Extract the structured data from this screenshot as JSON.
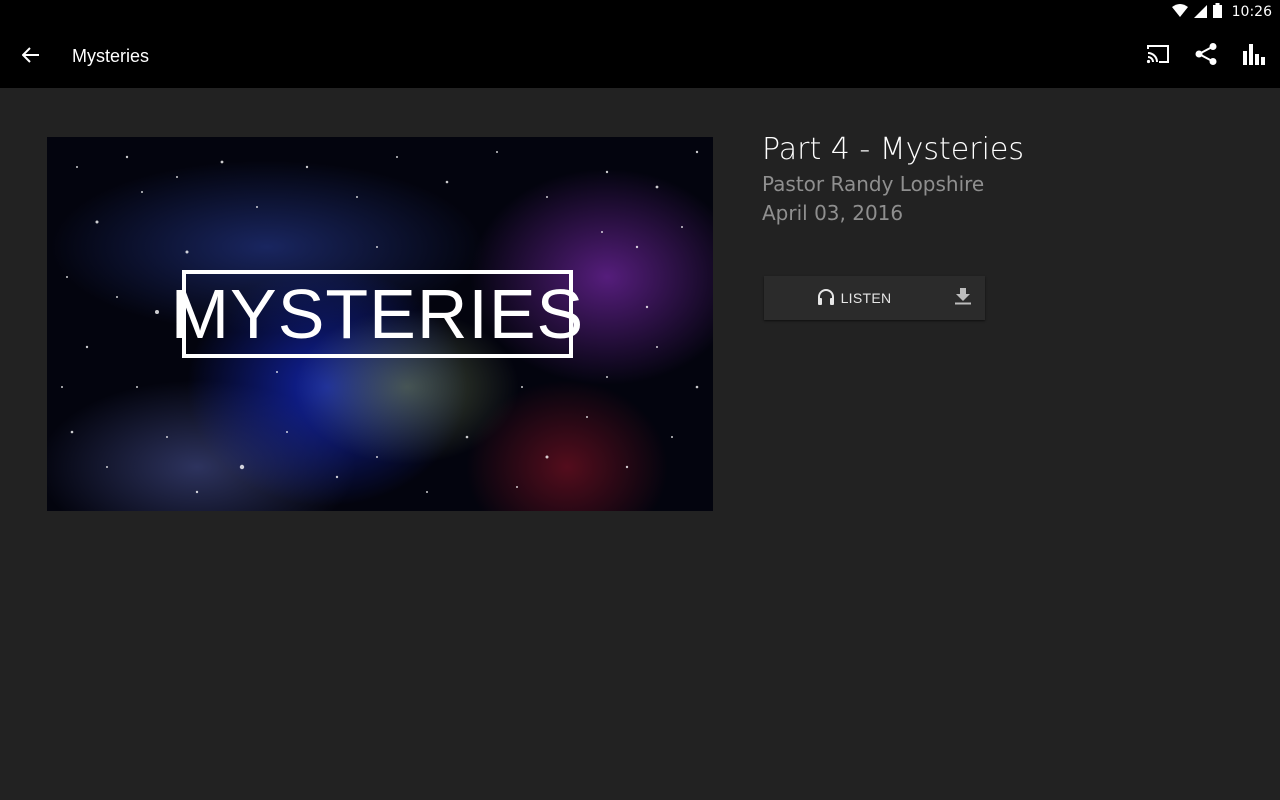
{
  "status_bar": {
    "time": "10:26",
    "icons": [
      "wifi-icon",
      "cell-signal-icon",
      "battery-icon"
    ]
  },
  "app_bar": {
    "back_icon": "arrow-back-icon",
    "title": "Mysteries",
    "actions": [
      "cast-icon",
      "share-icon",
      "bar-chart-icon"
    ]
  },
  "artwork": {
    "logo_text": "MYSTERIES"
  },
  "sermon": {
    "title": "Part 4 - Mysteries",
    "speaker": "Pastor Randy Lopshire",
    "date": "April 03, 2016"
  },
  "player": {
    "listen_label": "LISTEN",
    "listen_icon": "headphones-icon",
    "download_icon": "download-icon"
  },
  "colors": {
    "background": "#222222",
    "app_bar": "#000000",
    "secondary_text": "#8f8f8f",
    "button_bg": "#2b2b2b"
  }
}
